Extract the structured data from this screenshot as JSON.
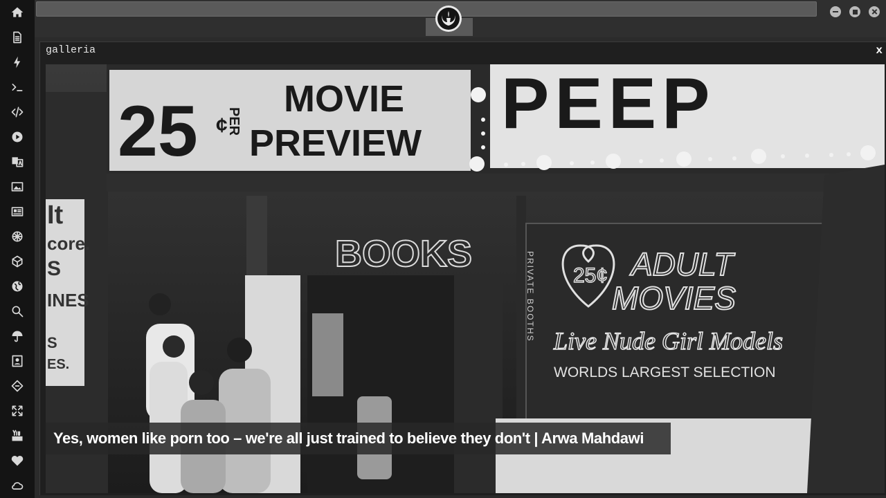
{
  "sidebar": {
    "icons": [
      "home-icon",
      "document-icon",
      "bolt-icon",
      "terminal-icon",
      "code-icon",
      "play-icon",
      "translate-icon",
      "image-icon",
      "news-icon",
      "settings-icon",
      "cube-icon",
      "globe-icon",
      "search-icon",
      "umbrella-icon",
      "contact-card-icon",
      "tag-icon",
      "fullscreen-icon",
      "youtube-icon",
      "heart-icon",
      "cloud-icon"
    ]
  },
  "window": {
    "title": "galleria",
    "close_label": "x"
  },
  "gallery": {
    "caption": "Yes, women like porn too – we're all just trained to believe they don't | Arwa Mahdawi",
    "sign_price": "25",
    "sign_cent": "¢",
    "sign_per": "PER",
    "sign_movie": "MOVIE",
    "sign_preview": "PREVIEW",
    "sign_peep": "PEEP",
    "neon_books": "BOOKS",
    "neon_price": "25¢",
    "neon_adult": "ADULT",
    "neon_movies": "MOVIES",
    "neon_live": "Live Nude Girl Models",
    "neon_selection": "WORLDS LARGEST SELECTION",
    "booths": "PRIVATE BOOTHS"
  },
  "colors": {
    "sidebar_bg": "#141414",
    "topbar_bg": "#2f2f2f",
    "window_bg": "#1f1f1f"
  }
}
